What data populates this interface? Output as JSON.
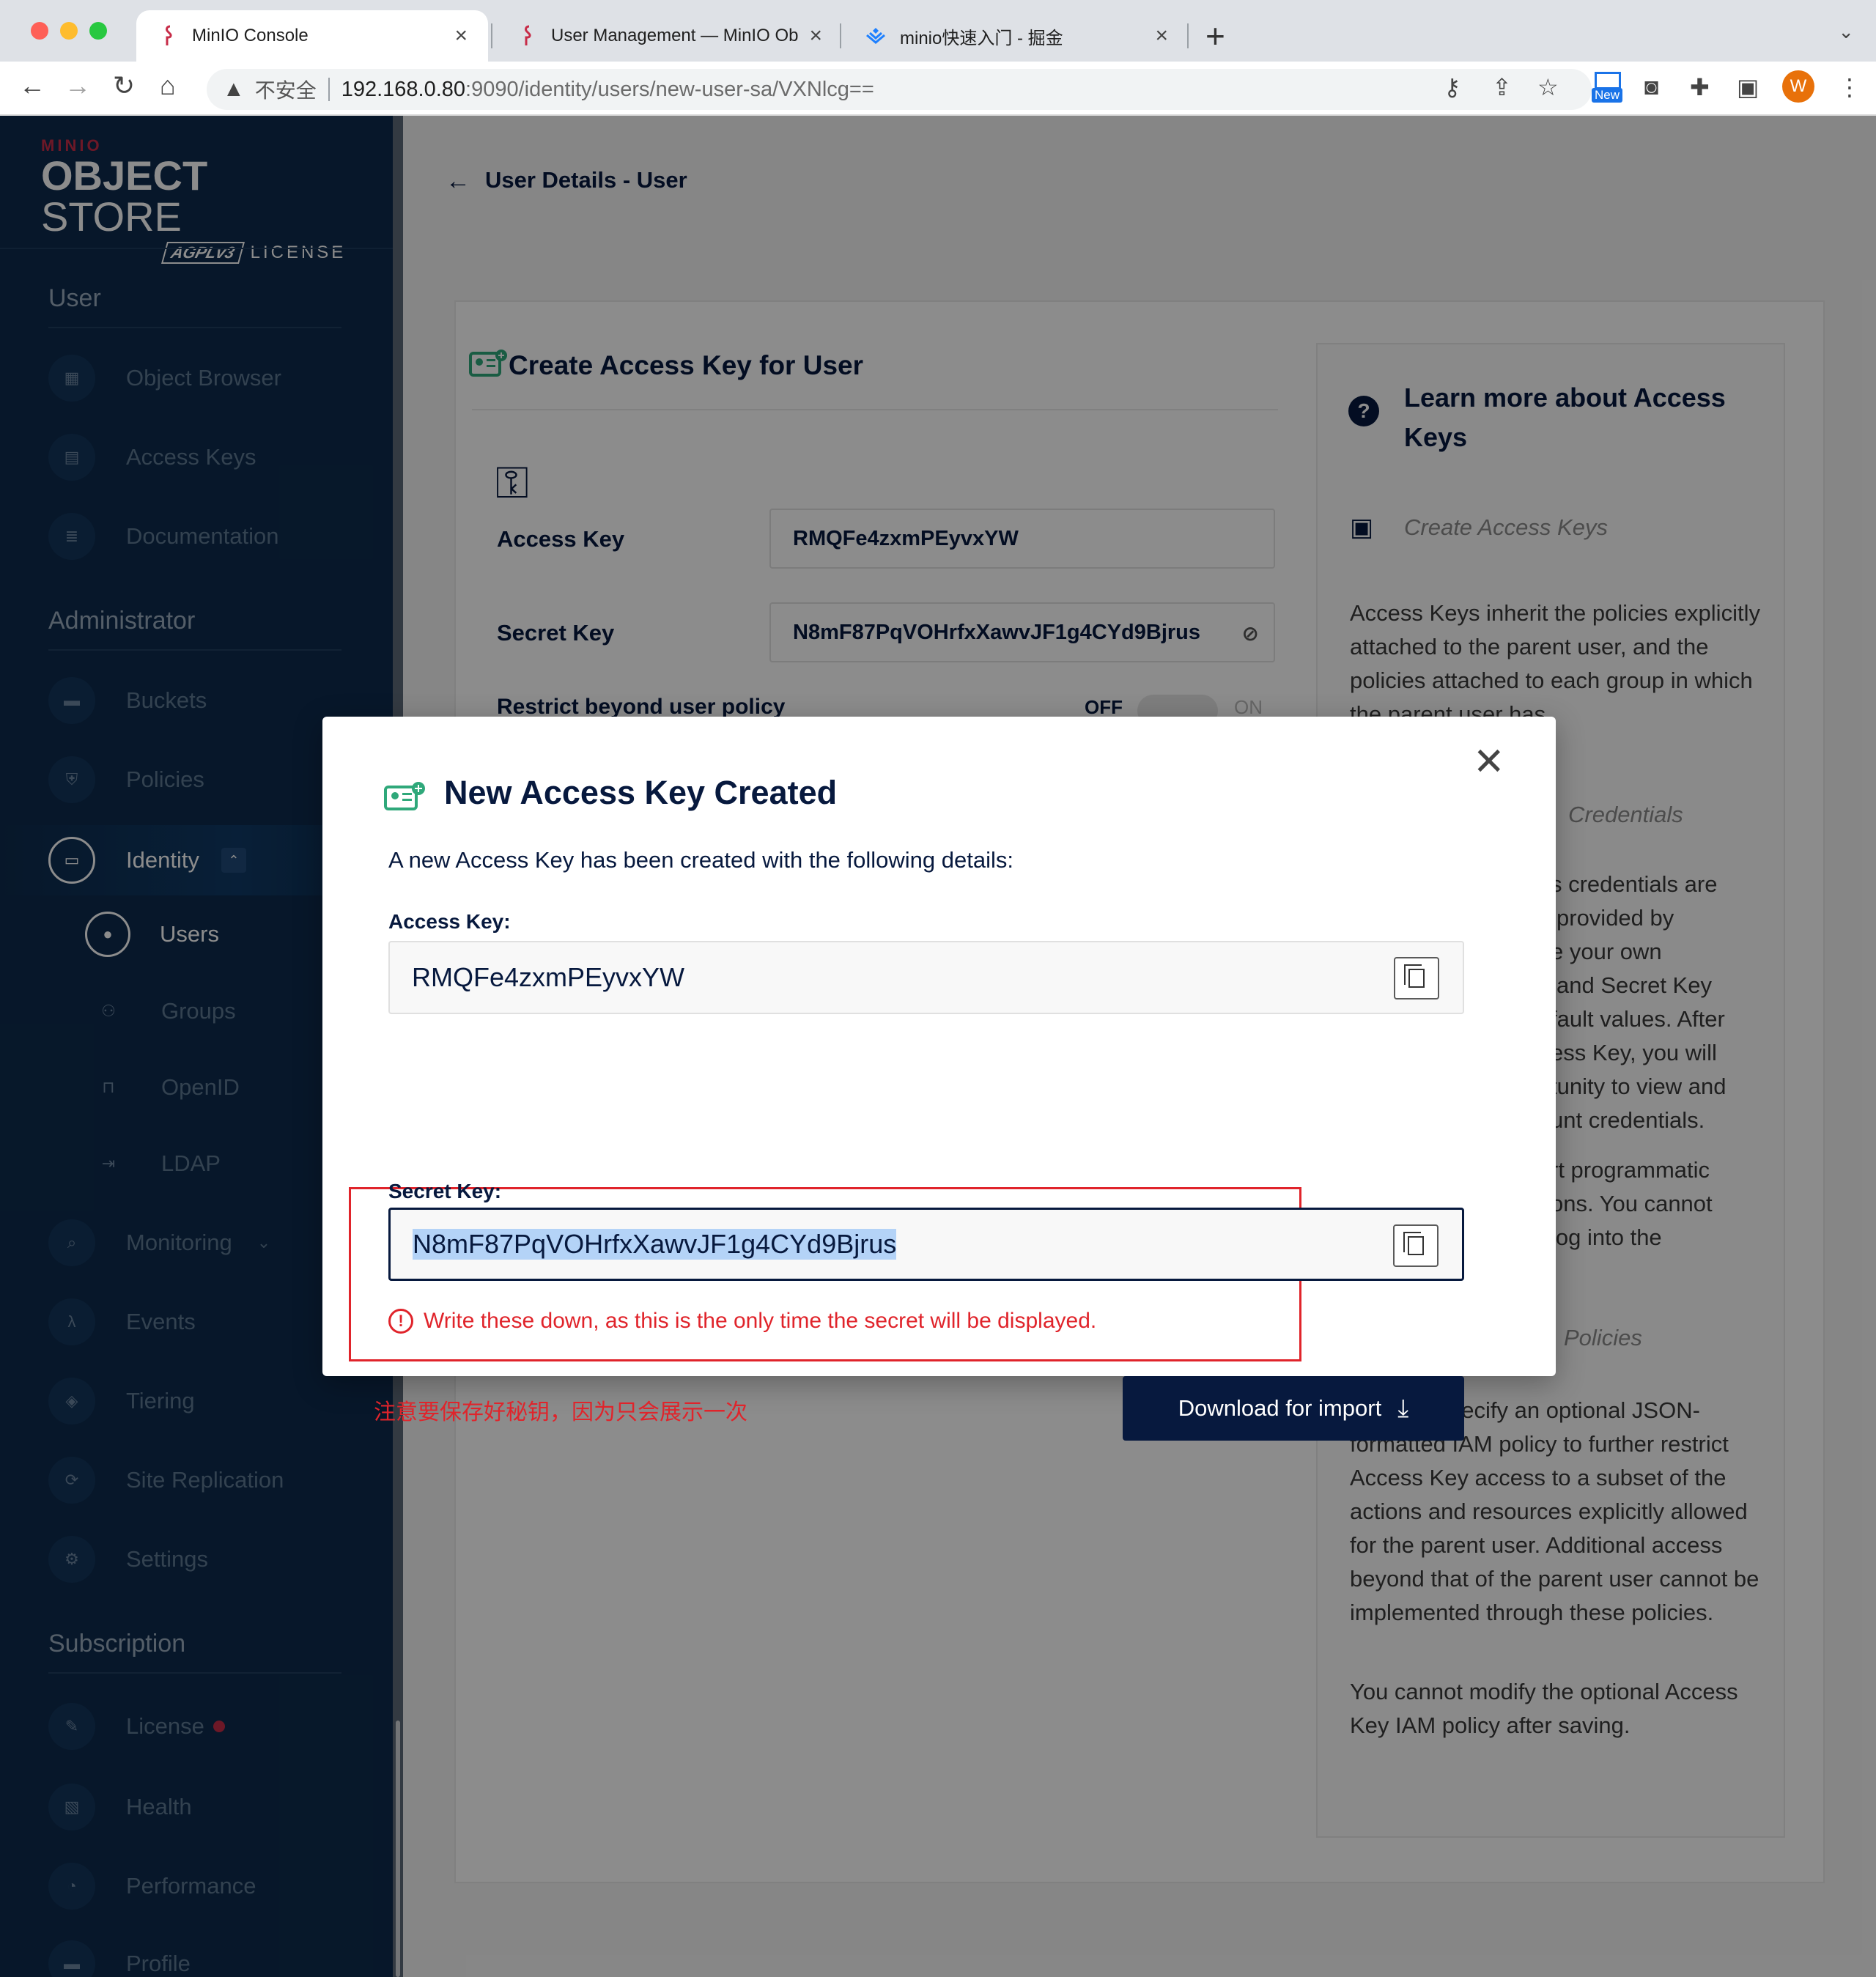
{
  "browser": {
    "tabs": [
      {
        "title": "MinIO Console",
        "close": "×"
      },
      {
        "title": "User Management — MinIO Ob",
        "close": "×"
      },
      {
        "title": "minio快速入门 - 掘金",
        "close": "×"
      }
    ],
    "new_tab": "+",
    "menu": "⌄",
    "address": {
      "insecure_label": "不安全",
      "host": "192.168.0.80",
      "path": ":9090/identity/users/new-user-sa/VXNlcg=="
    },
    "extension_new_label": "New",
    "profile_initial": "W"
  },
  "sidebar": {
    "logo": {
      "brand": "MINIO",
      "product_bold": "OBJECT",
      "product_light": " STORE",
      "edition": "AGPLv3",
      "license": "LICENSE"
    },
    "sections": {
      "user": "User",
      "administrator": "Administrator",
      "subscription": "Subscription"
    },
    "items": {
      "object_browser": "Object Browser",
      "access_keys": "Access Keys",
      "documentation": "Documentation",
      "buckets": "Buckets",
      "policies": "Policies",
      "identity": "Identity",
      "users": "Users",
      "groups": "Groups",
      "openid": "OpenID",
      "ldap": "LDAP",
      "monitoring": "Monitoring",
      "events": "Events",
      "tiering": "Tiering",
      "site_replication": "Site Replication",
      "settings": "Settings",
      "license": "License",
      "health": "Health",
      "performance": "Performance",
      "profile": "Profile"
    }
  },
  "page": {
    "back_arrow": "←",
    "breadcrumb": "User Details - User",
    "form_title": "Create Access Key for User",
    "access_key_label": "Access Key",
    "access_key_value": "RMQFe4zxmPEyvxYW",
    "secret_key_label": "Secret Key",
    "secret_key_value": "N8mF87PqVOHrfxXawvJF1g4CYd9Bjrus",
    "restrict_label": "Restrict beyond user policy",
    "toggle_off": "OFF",
    "toggle_on": "ON"
  },
  "help": {
    "title": "Learn more about Access Keys",
    "sub_create": "Create Access Keys",
    "para1": "Access Keys inherit the policies explicitly attached to the parent user, and the policies attached to each group in which the parent user has",
    "sub_credentials": "Credentials",
    "para2_fragments": [
      "s credentials are",
      "provided by",
      "e your own",
      "and Secret Key",
      "fault values. After",
      "ess Key, you will",
      "tunity to view and",
      "unt credentials."
    ],
    "para3_fragments": [
      "rt programmatic",
      "ons. You cannot",
      "log into the"
    ],
    "sub_policies": "Policies",
    "para4": "You can specify an optional JSON-formatted IAM policy to further restrict Access Key access to a subset of the actions and resources explicitly allowed for the parent user. Additional access beyond that of the parent user cannot be implemented through these policies.",
    "para5": "You cannot modify the optional Access Key IAM policy after saving."
  },
  "modal": {
    "close": "✕",
    "title": "New Access Key Created",
    "description": "A new Access Key has been created with the following details:",
    "access_key_label": "Access Key:",
    "access_key_value": "RMQFe4zxmPEyvxYW",
    "secret_key_label": "Secret Key:",
    "secret_key_value": "N8mF87PqVOHrfxXawvJF1g4CYd9Bjrus",
    "warning": "Write these down, as this is the only time the secret will be displayed.",
    "annotation": "注意要保存好秘钥，因为只会展示一次",
    "download_label": "Download for import",
    "colors": {
      "navy": "#07193e",
      "warning_red": "#e0242b",
      "selection": "#b4d3f7"
    }
  }
}
